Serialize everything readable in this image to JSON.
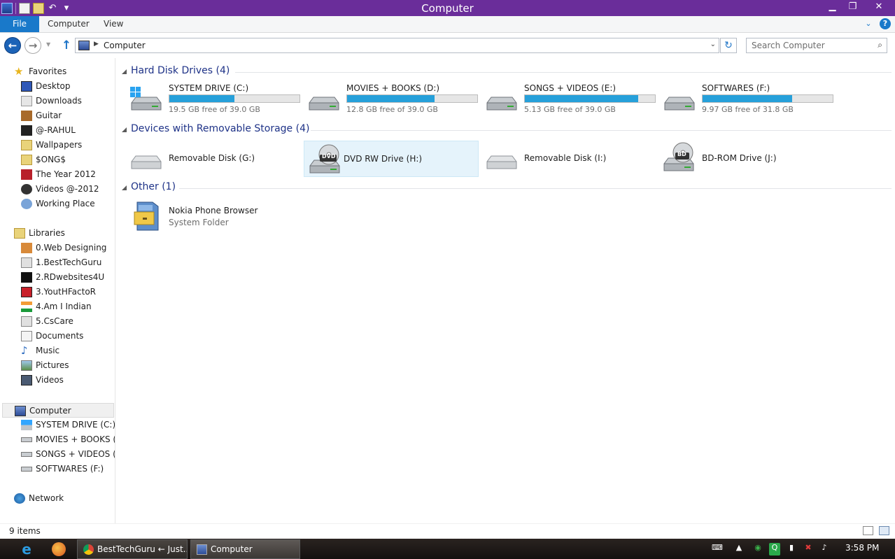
{
  "window": {
    "title": "Computer"
  },
  "ribbon": {
    "tabs": [
      "File",
      "Computer",
      "View"
    ]
  },
  "address": {
    "crumb": "Computer"
  },
  "search": {
    "placeholder": "Search Computer"
  },
  "nav": {
    "favorites": {
      "label": "Favorites",
      "items": [
        "Desktop",
        "Downloads",
        "Guitar",
        "@-RAHUL",
        "Wallpapers",
        "$ONG$",
        "The Year 2012",
        "Videos @-2012",
        "Working Place"
      ]
    },
    "libraries": {
      "label": "Libraries",
      "items": [
        "0.Web Designing",
        "1.BestTechGuru",
        "2.RDwebsites4U",
        "3.YoutHFactoR",
        "4.Am I Indian",
        "5.CsCare",
        "Documents",
        "Music",
        "Pictures",
        "Videos"
      ]
    },
    "computer": {
      "label": "Computer",
      "items": [
        "SYSTEM DRIVE (C:)",
        "MOVIES + BOOKS (D:",
        "SONGS + VIDEOS (E:)",
        "SOFTWARES (F:)"
      ]
    },
    "network": {
      "label": "Network"
    }
  },
  "sections": {
    "hdd": {
      "title": "Hard Disk Drives (4)",
      "drives": [
        {
          "name": "SYSTEM DRIVE (C:)",
          "free": "19.5 GB free of 39.0 GB",
          "used_fraction": 0.5
        },
        {
          "name": "MOVIES + BOOKS (D:)",
          "free": "12.8 GB free of 39.0 GB",
          "used_fraction": 0.67
        },
        {
          "name": "SONGS + VIDEOS (E:)",
          "free": "5.13 GB free of 39.0 GB",
          "used_fraction": 0.87
        },
        {
          "name": "SOFTWARES (F:)",
          "free": "9.97 GB free of 31.8 GB",
          "used_fraction": 0.69
        }
      ]
    },
    "removable": {
      "title": "Devices with Removable Storage (4)",
      "devices": [
        {
          "name": "Removable Disk (G:)",
          "badge": ""
        },
        {
          "name": "DVD RW Drive (H:)",
          "badge": "DVD"
        },
        {
          "name": "Removable Disk (I:)",
          "badge": ""
        },
        {
          "name": "BD-ROM Drive (J:)",
          "badge": "BD"
        }
      ]
    },
    "other": {
      "title": "Other (1)",
      "items": [
        {
          "name": "Nokia Phone Browser",
          "subtitle": "System Folder"
        }
      ]
    }
  },
  "status": {
    "count": "9 items"
  },
  "taskbar": {
    "tasks": [
      "BestTechGuru ← Just...",
      "Computer"
    ],
    "clock": "3:58 PM"
  },
  "colors": {
    "title_bar": "#6a2d9a",
    "accent": "#1979ca",
    "bar_fill": "#26a0da",
    "section_title": "#1e3287"
  }
}
